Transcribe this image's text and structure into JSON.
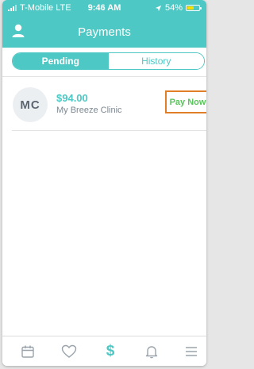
{
  "status_bar": {
    "carrier": "T-Mobile",
    "network": "LTE",
    "time": "9:46 AM",
    "battery": "54%",
    "battery_level": 0.54
  },
  "header": {
    "title": "Payments"
  },
  "segment": {
    "pending_label": "Pending",
    "history_label": "History",
    "active": "Pending"
  },
  "payments": [
    {
      "initials": "MC",
      "amount": "$94.00",
      "clinic": "My Breeze Clinic",
      "action_label": "Pay Now"
    }
  ],
  "tabbar": {
    "icons": [
      "calendar-icon",
      "heart-icon",
      "dollar-icon",
      "bell-icon",
      "menu-icon"
    ],
    "dollar_glyph": "$",
    "active": "dollar-icon"
  },
  "colors": {
    "accent": "#4ec8c4",
    "pay_now_text": "#56c557",
    "highlight_border": "#e07f27"
  }
}
